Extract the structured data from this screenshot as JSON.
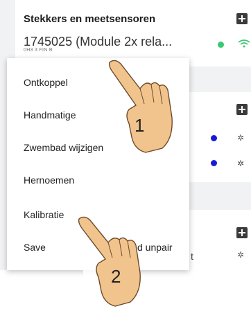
{
  "section": {
    "title": "Stekkers en meetsensoren"
  },
  "device": {
    "name": "1745025 (Module 2x rela...",
    "subtitle": "0H3 3 FIN B",
    "status_color": "#3cc873"
  },
  "menu": {
    "items": [
      {
        "label": "Ontkoppel"
      },
      {
        "label": "Handmatige"
      },
      {
        "label": "Zwembad wijzigen"
      },
      {
        "label": "Hernoemen"
      },
      {
        "label": "Kalibratie"
      },
      {
        "label": "Save"
      },
      {
        "label": "d unpair"
      }
    ]
  },
  "annotations": {
    "step1": "1",
    "step2": "2"
  },
  "colors": {
    "accent_green": "#3cc873",
    "accent_blue": "#1a1ad6"
  },
  "icons": [
    "plus-icon",
    "wifi-icon",
    "gear-icon",
    "pointing-hand-icon"
  ]
}
